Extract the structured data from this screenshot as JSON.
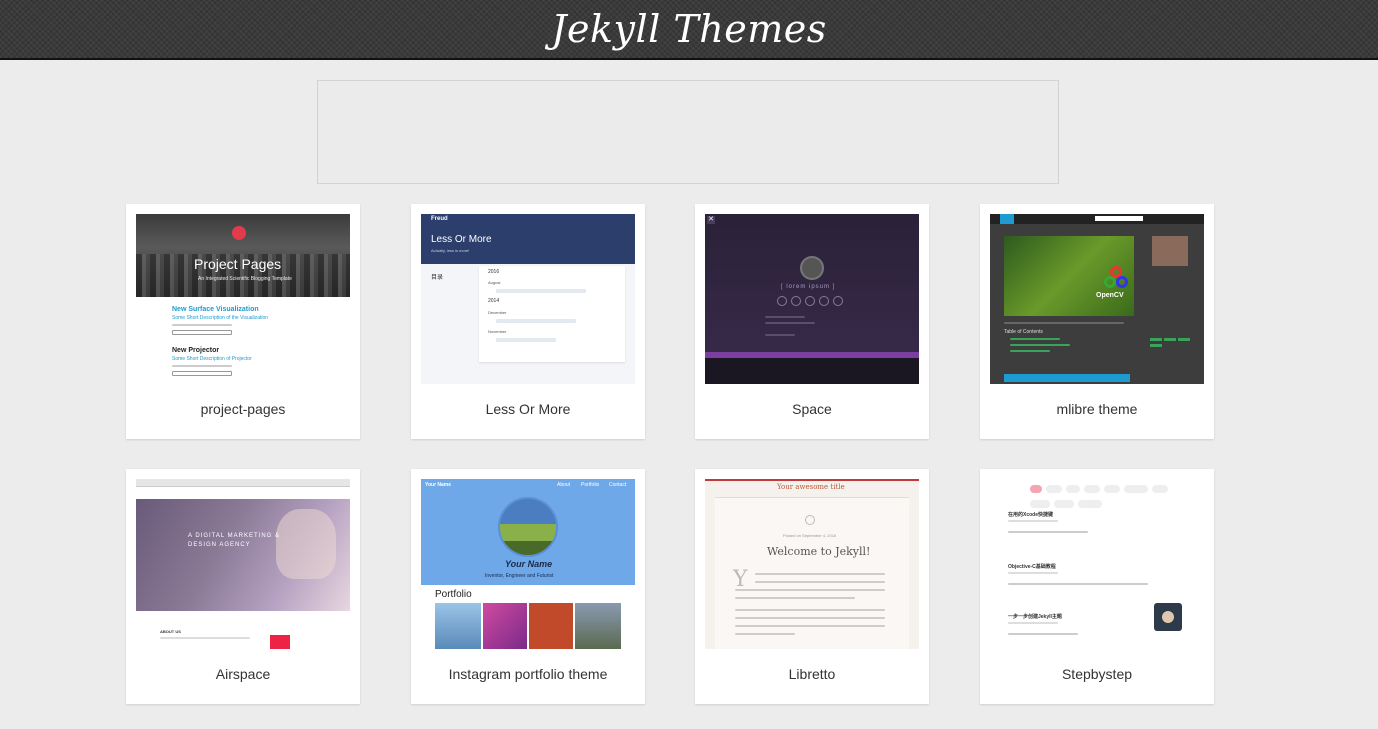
{
  "header": {
    "title": "Jekyll Themes"
  },
  "themes": [
    {
      "name": "project-pages"
    },
    {
      "name": "Less Or More"
    },
    {
      "name": "Space"
    },
    {
      "name": "mlibre theme"
    },
    {
      "name": "Airspace"
    },
    {
      "name": "Instagram portfolio theme"
    },
    {
      "name": "Libretto"
    },
    {
      "name": "Stepbystep"
    }
  ],
  "previews": {
    "project_pages": {
      "hero_title": "Project Pages",
      "hero_sub": "An Integrated Scientific Blogging Template",
      "post1_title": "New Surface Visualization",
      "post1_sub": "Some Short Description of the Visualization",
      "post2_title": "New Projector",
      "post2_sub": "Some Short Description of Projector"
    },
    "less_or_more": {
      "brand": "Freud",
      "heading": "Less Or More",
      "sub": "Actually, less is more!",
      "sidebar_title": "目录",
      "year1": "2016",
      "month1": "August",
      "year2": "2014",
      "month2": "December",
      "month3": "November"
    },
    "space": {
      "tagline": "[ lorem ipsum ]"
    },
    "mlibre": {
      "logo_text": "OpenCV",
      "toc_title": "Table of Contents"
    },
    "airspace": {
      "hero_line1": "A DIGITAL MARKETING &",
      "hero_line2": "DESIGN AGENCY",
      "about": "ABOUT US"
    },
    "instagram": {
      "brand": "Your Name",
      "nav": [
        "About",
        "Portfolio",
        "Contact"
      ],
      "name": "Your Name",
      "tagline": "Inventor, Engineer and Futurist",
      "section": "Portfolio"
    },
    "libretto": {
      "site_title": "Your awesome title",
      "date": "Posted on September 4, 2016",
      "heading": "Welcome to Jekyll!",
      "dropcap": "Y"
    },
    "stepbystep": {
      "post1": "在用的Xcode快捷键",
      "post2": "Objective-C基础教程",
      "post3": "一步一步创建Jekyll主题"
    }
  },
  "colors": {
    "header_bg": "#3a3a3a",
    "page_bg": "#ececec",
    "card_bg": "#ffffff",
    "accent_teal": "#1e9bd0",
    "less_blue": "#2c3e6b",
    "space_purple": "#2e2340",
    "instagram_blue": "#6fa8e8"
  }
}
